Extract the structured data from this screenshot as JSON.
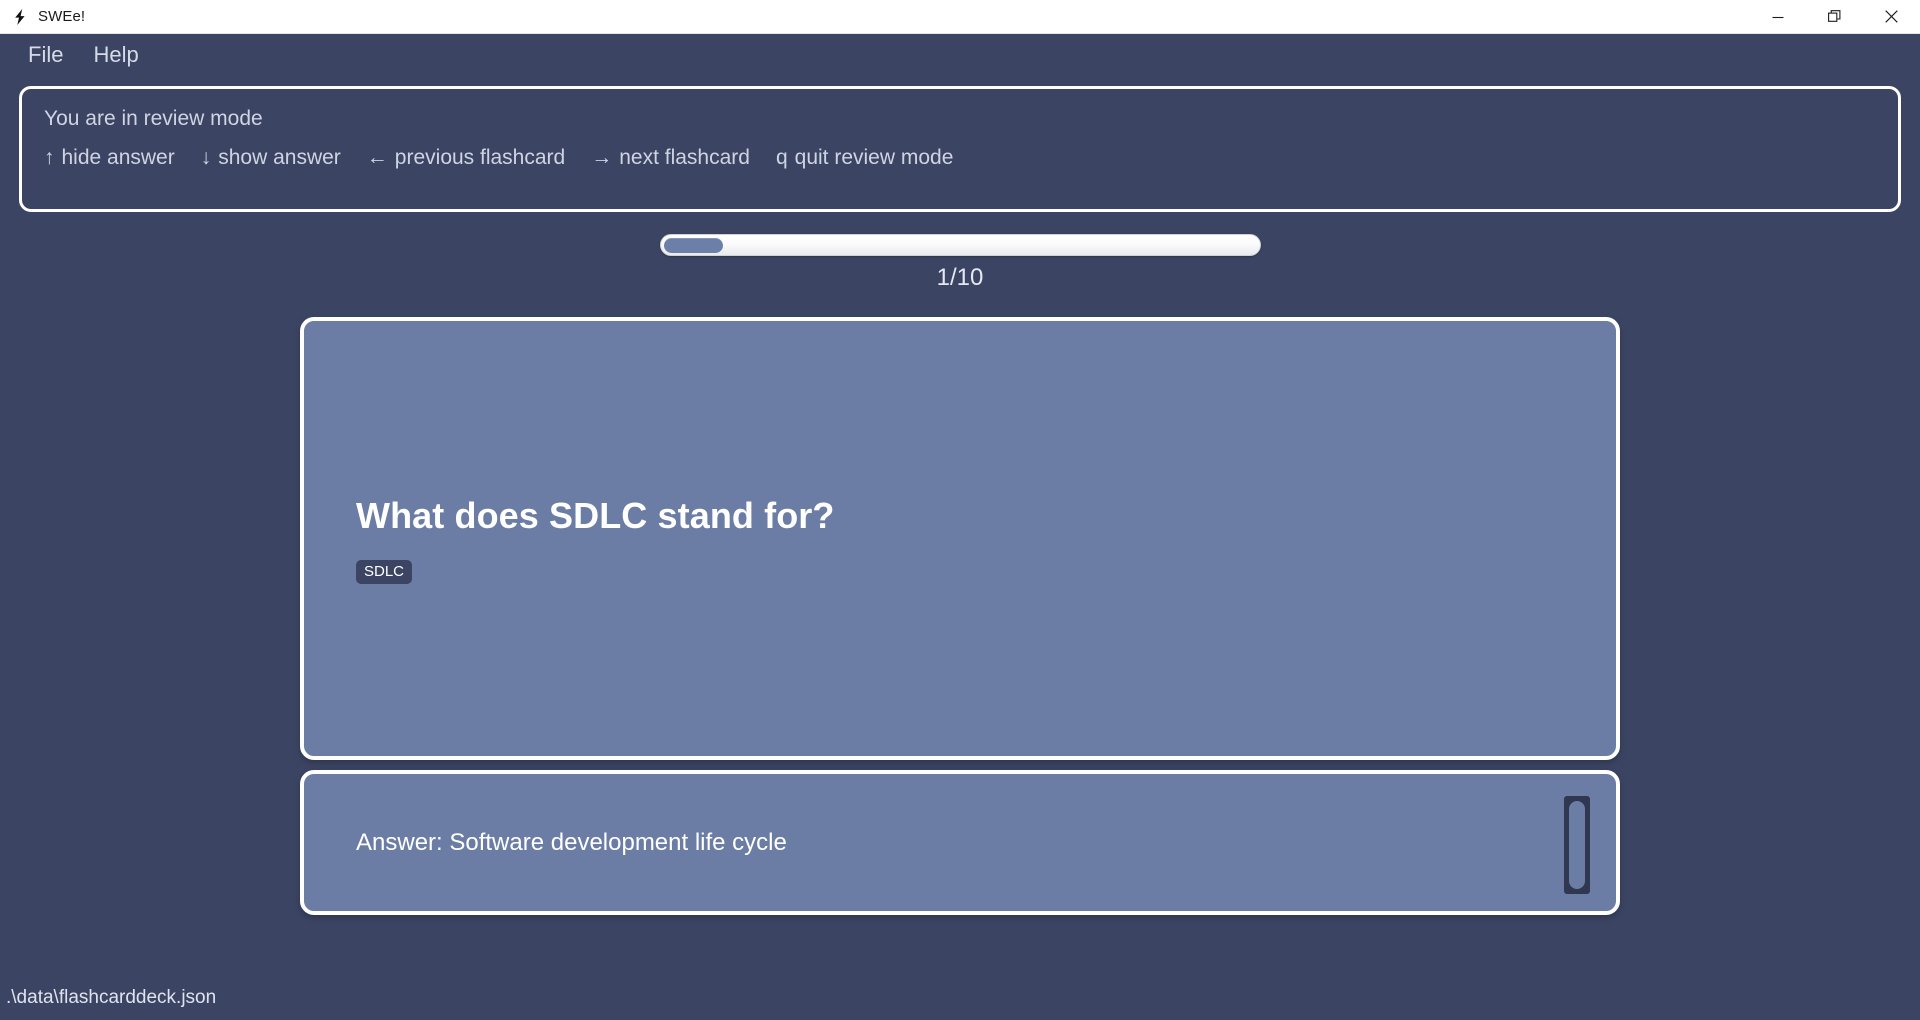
{
  "window": {
    "title": "SWEe!",
    "icon": "lightning-bolt-icon",
    "controls": {
      "minimize": "minimize-icon",
      "maximize": "restore-icon",
      "close": "close-icon"
    }
  },
  "menubar": {
    "items": [
      {
        "label": "File"
      },
      {
        "label": "Help"
      }
    ]
  },
  "banner": {
    "title": "You are in review mode",
    "hints": [
      {
        "key": "↑",
        "label": "hide answer"
      },
      {
        "key": "↓",
        "label": "show answer"
      },
      {
        "key": "←",
        "label": "previous flashcard"
      },
      {
        "key": "→",
        "label": "next flashcard"
      },
      {
        "key": "q",
        "label": "quit review mode"
      }
    ]
  },
  "progress": {
    "current": 1,
    "total": 10,
    "label": "1/10",
    "percent": 10,
    "fill_color": "#6c7fa8",
    "track_color": "#ffffff"
  },
  "flashcard": {
    "question": "What does SDLC stand for?",
    "tags": [
      "SDLC"
    ],
    "answer": "Answer: Software development life cycle",
    "card_color": "#6b7da4",
    "border_color": "#ffffff"
  },
  "statusbar": {
    "path": ".\\data\\flashcarddeck.json"
  },
  "theme": {
    "background": "#3b4563",
    "text": "#e8eaf2",
    "muted_text": "#cfd4e3",
    "tag_background": "#3b4563"
  }
}
